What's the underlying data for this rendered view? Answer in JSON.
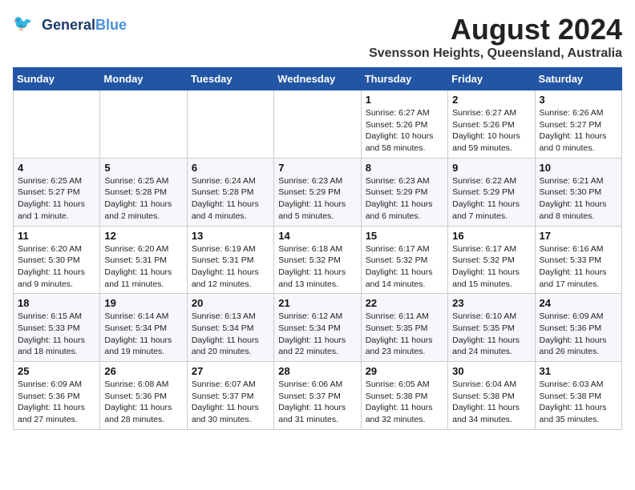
{
  "header": {
    "logo_line1": "General",
    "logo_line2": "Blue",
    "month_year": "August 2024",
    "location": "Svensson Heights, Queensland, Australia"
  },
  "days_of_week": [
    "Sunday",
    "Monday",
    "Tuesday",
    "Wednesday",
    "Thursday",
    "Friday",
    "Saturday"
  ],
  "weeks": [
    [
      {
        "day": "",
        "info": ""
      },
      {
        "day": "",
        "info": ""
      },
      {
        "day": "",
        "info": ""
      },
      {
        "day": "",
        "info": ""
      },
      {
        "day": "1",
        "info": "Sunrise: 6:27 AM\nSunset: 5:26 PM\nDaylight: 10 hours and 58 minutes."
      },
      {
        "day": "2",
        "info": "Sunrise: 6:27 AM\nSunset: 5:26 PM\nDaylight: 10 hours and 59 minutes."
      },
      {
        "day": "3",
        "info": "Sunrise: 6:26 AM\nSunset: 5:27 PM\nDaylight: 11 hours and 0 minutes."
      }
    ],
    [
      {
        "day": "4",
        "info": "Sunrise: 6:25 AM\nSunset: 5:27 PM\nDaylight: 11 hours and 1 minute."
      },
      {
        "day": "5",
        "info": "Sunrise: 6:25 AM\nSunset: 5:28 PM\nDaylight: 11 hours and 2 minutes."
      },
      {
        "day": "6",
        "info": "Sunrise: 6:24 AM\nSunset: 5:28 PM\nDaylight: 11 hours and 4 minutes."
      },
      {
        "day": "7",
        "info": "Sunrise: 6:23 AM\nSunset: 5:29 PM\nDaylight: 11 hours and 5 minutes."
      },
      {
        "day": "8",
        "info": "Sunrise: 6:23 AM\nSunset: 5:29 PM\nDaylight: 11 hours and 6 minutes."
      },
      {
        "day": "9",
        "info": "Sunrise: 6:22 AM\nSunset: 5:29 PM\nDaylight: 11 hours and 7 minutes."
      },
      {
        "day": "10",
        "info": "Sunrise: 6:21 AM\nSunset: 5:30 PM\nDaylight: 11 hours and 8 minutes."
      }
    ],
    [
      {
        "day": "11",
        "info": "Sunrise: 6:20 AM\nSunset: 5:30 PM\nDaylight: 11 hours and 9 minutes."
      },
      {
        "day": "12",
        "info": "Sunrise: 6:20 AM\nSunset: 5:31 PM\nDaylight: 11 hours and 11 minutes."
      },
      {
        "day": "13",
        "info": "Sunrise: 6:19 AM\nSunset: 5:31 PM\nDaylight: 11 hours and 12 minutes."
      },
      {
        "day": "14",
        "info": "Sunrise: 6:18 AM\nSunset: 5:32 PM\nDaylight: 11 hours and 13 minutes."
      },
      {
        "day": "15",
        "info": "Sunrise: 6:17 AM\nSunset: 5:32 PM\nDaylight: 11 hours and 14 minutes."
      },
      {
        "day": "16",
        "info": "Sunrise: 6:17 AM\nSunset: 5:32 PM\nDaylight: 11 hours and 15 minutes."
      },
      {
        "day": "17",
        "info": "Sunrise: 6:16 AM\nSunset: 5:33 PM\nDaylight: 11 hours and 17 minutes."
      }
    ],
    [
      {
        "day": "18",
        "info": "Sunrise: 6:15 AM\nSunset: 5:33 PM\nDaylight: 11 hours and 18 minutes."
      },
      {
        "day": "19",
        "info": "Sunrise: 6:14 AM\nSunset: 5:34 PM\nDaylight: 11 hours and 19 minutes."
      },
      {
        "day": "20",
        "info": "Sunrise: 6:13 AM\nSunset: 5:34 PM\nDaylight: 11 hours and 20 minutes."
      },
      {
        "day": "21",
        "info": "Sunrise: 6:12 AM\nSunset: 5:34 PM\nDaylight: 11 hours and 22 minutes."
      },
      {
        "day": "22",
        "info": "Sunrise: 6:11 AM\nSunset: 5:35 PM\nDaylight: 11 hours and 23 minutes."
      },
      {
        "day": "23",
        "info": "Sunrise: 6:10 AM\nSunset: 5:35 PM\nDaylight: 11 hours and 24 minutes."
      },
      {
        "day": "24",
        "info": "Sunrise: 6:09 AM\nSunset: 5:36 PM\nDaylight: 11 hours and 26 minutes."
      }
    ],
    [
      {
        "day": "25",
        "info": "Sunrise: 6:09 AM\nSunset: 5:36 PM\nDaylight: 11 hours and 27 minutes."
      },
      {
        "day": "26",
        "info": "Sunrise: 6:08 AM\nSunset: 5:36 PM\nDaylight: 11 hours and 28 minutes."
      },
      {
        "day": "27",
        "info": "Sunrise: 6:07 AM\nSunset: 5:37 PM\nDaylight: 11 hours and 30 minutes."
      },
      {
        "day": "28",
        "info": "Sunrise: 6:06 AM\nSunset: 5:37 PM\nDaylight: 11 hours and 31 minutes."
      },
      {
        "day": "29",
        "info": "Sunrise: 6:05 AM\nSunset: 5:38 PM\nDaylight: 11 hours and 32 minutes."
      },
      {
        "day": "30",
        "info": "Sunrise: 6:04 AM\nSunset: 5:38 PM\nDaylight: 11 hours and 34 minutes."
      },
      {
        "day": "31",
        "info": "Sunrise: 6:03 AM\nSunset: 5:38 PM\nDaylight: 11 hours and 35 minutes."
      }
    ]
  ]
}
